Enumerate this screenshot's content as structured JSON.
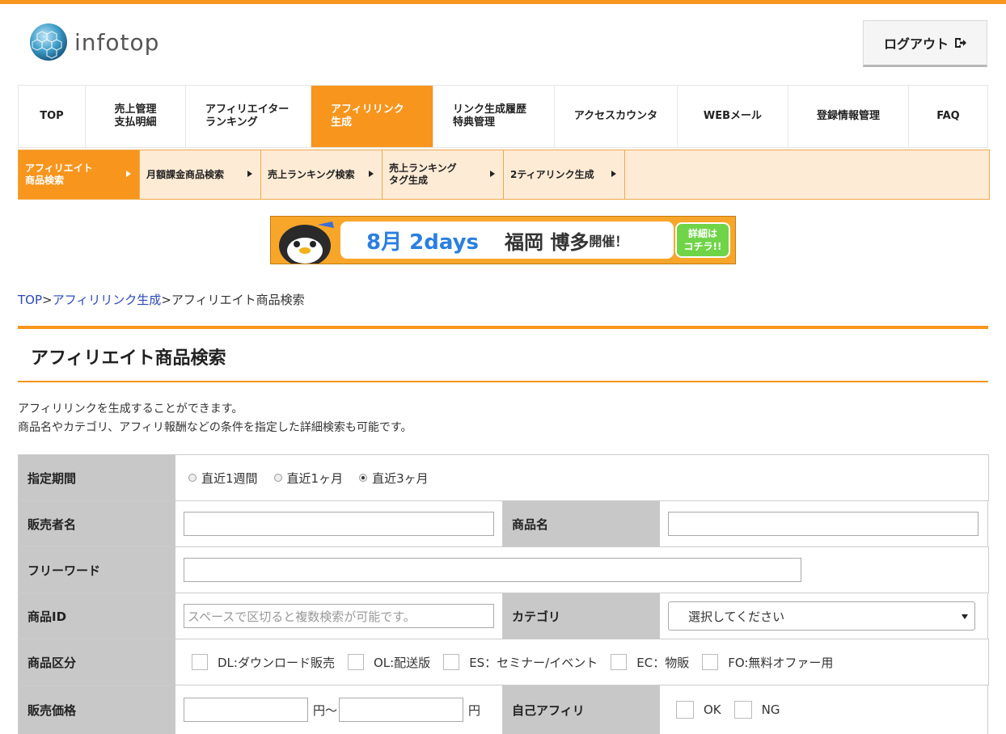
{
  "logo": {
    "text": "infotop"
  },
  "header": {
    "logout_label": "ログアウト"
  },
  "nav": {
    "items": [
      {
        "line1": "TOP",
        "line2": ""
      },
      {
        "line1": "売上管理",
        "line2": "支払明細"
      },
      {
        "line1": "アフィリエイター",
        "line2": "ランキング"
      },
      {
        "line1": "アフィリリンク",
        "line2": "生成"
      },
      {
        "line1": "リンク生成履歴",
        "line2": "特典管理"
      },
      {
        "line1": "アクセスカウンタ",
        "line2": ""
      },
      {
        "line1": "WEBメール",
        "line2": ""
      },
      {
        "line1": "登録情報管理",
        "line2": ""
      },
      {
        "line1": "FAQ",
        "line2": ""
      }
    ],
    "active_index": 3,
    "active_color": "#f7951d"
  },
  "subnav": {
    "items": [
      {
        "line1": "アフィリエイト",
        "line2": "商品検索"
      },
      {
        "line1": "月額課金商品検索",
        "line2": ""
      },
      {
        "line1": "売上ランキング検索",
        "line2": ""
      },
      {
        "line1": "売上ランキング",
        "line2": "タグ生成"
      },
      {
        "line1": "2ティアリンク生成",
        "line2": ""
      }
    ],
    "active_index": 0
  },
  "banner": {
    "date": "8月 2days",
    "place": "福岡 博多",
    "suffix": "開催！",
    "button_line1": "詳細は",
    "button_line2": "コチラ!!"
  },
  "breadcrumb": {
    "top": "TOP",
    "sep1": ">",
    "link": "アフィリリンク生成",
    "sep2": ">",
    "current": "アフィリエイト商品検索"
  },
  "page": {
    "title": "アフィリエイト商品検索",
    "desc_line1": "アフィリリンクを生成することができます。",
    "desc_line2": "商品名やカテゴリ、アフィリ報酬などの条件を指定した詳細検索も可能です。"
  },
  "form": {
    "period": {
      "label": "指定期間",
      "options": [
        "直近1週間",
        "直近1ヶ月",
        "直近3ヶ月"
      ],
      "selected": "直近3ヶ月"
    },
    "seller": {
      "label": "販売者名",
      "value": ""
    },
    "product_name": {
      "label": "商品名",
      "value": ""
    },
    "freeword": {
      "label": "フリーワード",
      "value": ""
    },
    "product_id": {
      "label": "商品ID",
      "placeholder": "スペースで区切ると複数検索が可能です。"
    },
    "category": {
      "label": "カテゴリ",
      "selected": "選択してください"
    },
    "product_type": {
      "label": "商品区分",
      "options": [
        "DL:ダウンロード販売",
        "OL:配送版",
        "ES：セミナー/イベント",
        "EC：物販",
        "FO:無料オファー用"
      ]
    },
    "price": {
      "label": "販売価格",
      "from_unit": "円～",
      "to_unit": "円"
    },
    "self_affiliate": {
      "label": "自己アフィリ",
      "options": [
        "OK",
        "NG"
      ]
    }
  }
}
